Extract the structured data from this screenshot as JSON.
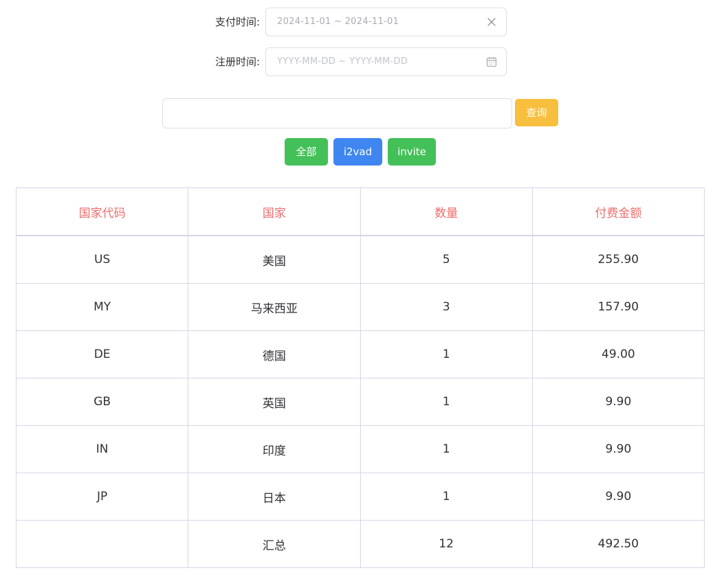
{
  "filters": {
    "pay_time": {
      "label": "支付时间:",
      "value": "2024-11-01 ~ 2024-11-01",
      "icon": "close-icon"
    },
    "register_time": {
      "label": "注册时间:",
      "placeholder": "YYYY-MM-DD ~ YYYY-MM-DD",
      "icon": "calendar-icon"
    }
  },
  "search": {
    "value": "",
    "button_label": "查询"
  },
  "source_buttons": [
    "全部",
    "i2vad",
    "invite"
  ],
  "colors": {
    "query": "#f8bf3e",
    "green": "#44c058",
    "blue": "#3f86f0",
    "header_text": "#ee6d6d",
    "border": "#d6d6e8"
  },
  "table": {
    "headers": [
      "国家代码",
      "国家",
      "数量",
      "付费金额"
    ],
    "rows": [
      [
        "US",
        "美国",
        "5",
        "255.90"
      ],
      [
        "MY",
        "马来西亚",
        "3",
        "157.90"
      ],
      [
        "DE",
        "德国",
        "1",
        "49.00"
      ],
      [
        "GB",
        "英国",
        "1",
        "9.90"
      ],
      [
        "IN",
        "印度",
        "1",
        "9.90"
      ],
      [
        "JP",
        "日本",
        "1",
        "9.90"
      ],
      [
        "",
        "汇总",
        "12",
        "492.50"
      ]
    ]
  }
}
